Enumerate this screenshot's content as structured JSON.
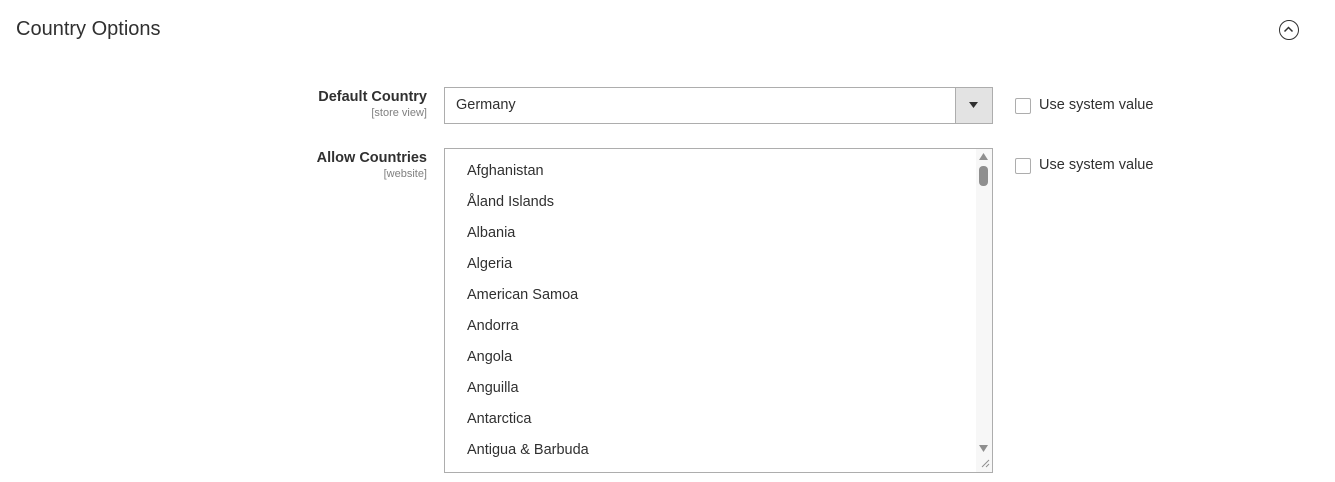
{
  "section": {
    "title": "Country Options"
  },
  "default_country": {
    "label": "Default Country",
    "scope": "[store view]",
    "value": "Germany",
    "use_system_value": "Use system value"
  },
  "allow_countries": {
    "label": "Allow Countries",
    "scope": "[website]",
    "use_system_value": "Use system value",
    "options": [
      "Afghanistan",
      "Åland Islands",
      "Albania",
      "Algeria",
      "American Samoa",
      "Andorra",
      "Angola",
      "Anguilla",
      "Antarctica",
      "Antigua & Barbuda"
    ]
  },
  "icons": {
    "collapse": "chevron-up-circle-icon",
    "dropdown": "triangle-down-icon"
  }
}
